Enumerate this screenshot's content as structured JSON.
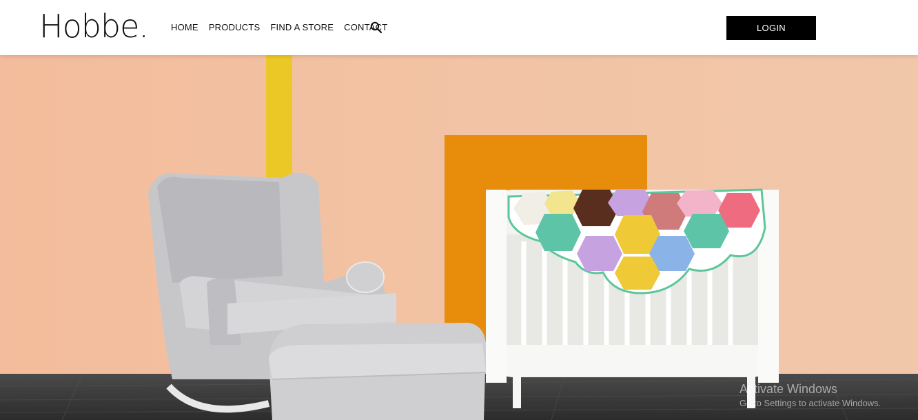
{
  "header": {
    "logo": "Hobbe.",
    "nav": [
      {
        "label": "HOME"
      },
      {
        "label": "PRODUCTS"
      },
      {
        "label": "FIND A STORE"
      },
      {
        "label": "CONTACT"
      }
    ],
    "search_icon": "search-icon",
    "login_label": "LOGIN"
  },
  "hero": {
    "image": "nursery scene with grey wingback rocking chair, ottoman and white crib with hexagon crochet blanket"
  },
  "watermark": {
    "line1": "Activate Windows",
    "line2": "Go to Settings to activate Windows."
  },
  "colors": {
    "wall": "#f2c3a4",
    "yellow_stripe": "#ecc827",
    "orange_panel": "#e88c0c",
    "floor": "#3a3a3a",
    "login_bg": "#000000"
  }
}
